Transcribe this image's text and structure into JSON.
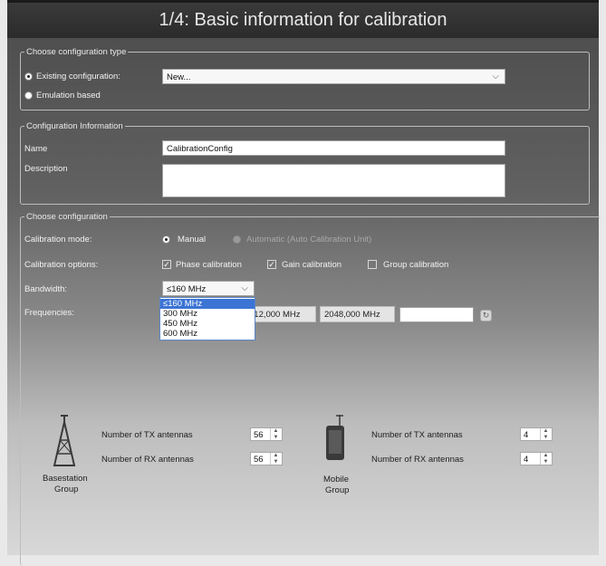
{
  "title": "1/4: Basic information for calibration",
  "config_type": {
    "legend": "Choose configuration type",
    "existing_label": "Existing configuration:",
    "emulation_label": "Emulation based",
    "existing_value": "New..."
  },
  "config_info": {
    "legend": "Configuration Information",
    "name_label": "Name",
    "name_value": "CalibrationConfig",
    "description_label": "Description",
    "description_value": ""
  },
  "choose_config": {
    "legend": "Choose configuration",
    "mode_label": "Calibration mode:",
    "mode_manual": "Manual",
    "mode_auto": "Automatic (Auto Calibration Unit)",
    "options_label": "Calibration options:",
    "opt_phase": "Phase calibration",
    "opt_gain": "Gain calibration",
    "opt_group": "Group calibration",
    "opt_phase_checked": true,
    "opt_gain_checked": true,
    "opt_group_checked": false,
    "bandwidth_label": "Bandwidth:",
    "bandwidth_value": "≤160 MHz",
    "bandwidth_options": [
      "≤160 MHz",
      "300 MHz",
      "450 MHz",
      "600 MHz"
    ],
    "frequencies_label": "Frequencies:",
    "freq_1": "512,000 MHz",
    "freq_2": "2048,000 MHz",
    "freq_input": ""
  },
  "basestation": {
    "label_line1": "Basestation",
    "label_line2": "Group",
    "tx_label": "Number of TX antennas",
    "tx_value": "56",
    "rx_label": "Number of RX antennas",
    "rx_value": "56"
  },
  "mobile": {
    "label_line1": "Mobile",
    "label_line2": "Group",
    "tx_label": "Number of TX antennas",
    "tx_value": "4",
    "rx_label": "Number of RX antennas",
    "rx_value": "4"
  },
  "colors": {
    "title_bg": "#2e2e2e",
    "selection": "#3b74d4"
  }
}
